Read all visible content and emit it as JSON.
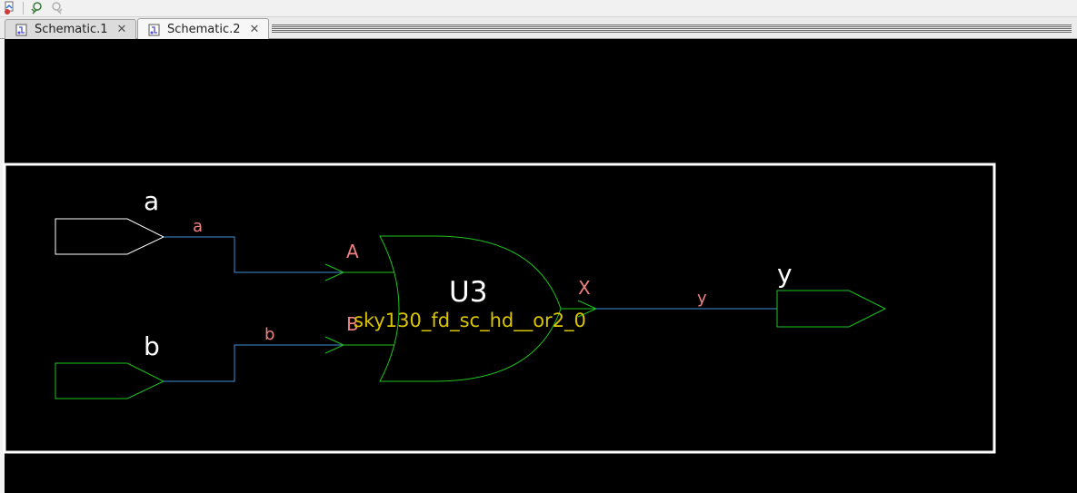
{
  "tabs": [
    {
      "label": "Schematic.1",
      "active": false
    },
    {
      "label": "Schematic.2",
      "active": true
    }
  ],
  "toolbar": {
    "icons": [
      "schematic-tool-icon",
      "zoom-back-icon",
      "zoom-forward-icon"
    ]
  },
  "schematic": {
    "ports": [
      {
        "name": "a",
        "net": "a",
        "direction": "input"
      },
      {
        "name": "b",
        "net": "b",
        "direction": "input"
      },
      {
        "name": "y",
        "net": "y",
        "direction": "output"
      }
    ],
    "cell": {
      "instance": "U3",
      "type": "sky130_fd_sc_hd__or2_0",
      "pins": [
        "A",
        "B",
        "X"
      ]
    },
    "nets": [
      "a",
      "b",
      "y"
    ]
  },
  "colors": {
    "wire": "#3f8fd6",
    "cell_outline": "#1fc21f",
    "pin_label": "#f08080",
    "net_label": "#f08080",
    "cell_type": "#d8c400",
    "instance_label": "#ffffff",
    "port_label": "#ffffff",
    "frame": "#ffffff"
  }
}
